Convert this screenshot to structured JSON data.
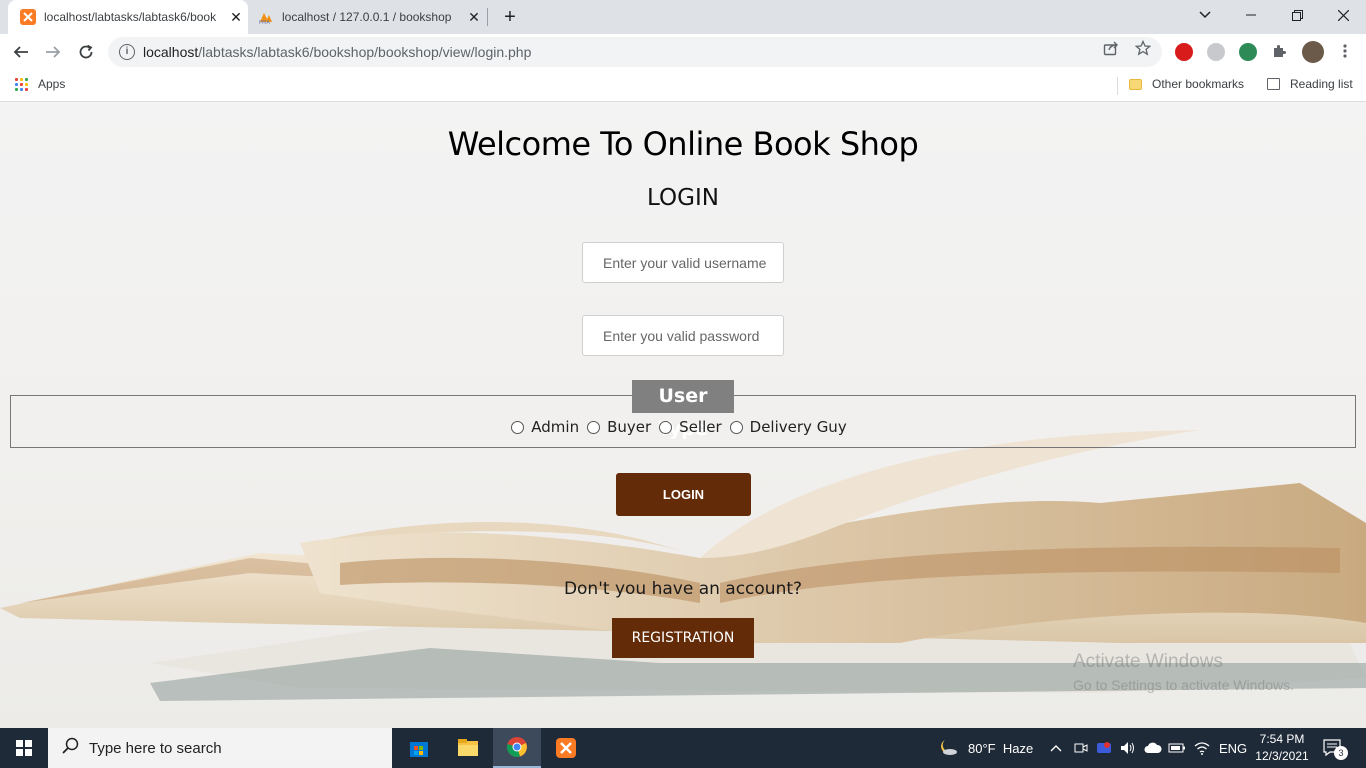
{
  "browser": {
    "tabs": [
      {
        "title": "localhost/labtasks/labtask6/book",
        "active": true
      },
      {
        "title": "localhost / 127.0.0.1 / bookshop",
        "active": false
      }
    ],
    "url_host": "localhost",
    "url_path": "/labtasks/labtask6/bookshop/bookshop/view/login.php",
    "bookmarks": {
      "apps": "Apps",
      "other": "Other bookmarks",
      "reading": "Reading list"
    }
  },
  "page": {
    "welcome": "Welcome To Online Book Shop",
    "login_heading": "LOGIN",
    "username_placeholder": "Enter your valid username",
    "password_placeholder": "Enter you valid password",
    "user_type_legend": "User Type",
    "user_types": [
      "Admin",
      "Buyer",
      "Seller",
      "Delivery Guy"
    ],
    "login_button": "LOGIN",
    "no_account": "Don't you have an account?",
    "registration_button": "REGISTRATION"
  },
  "watermark": {
    "title": "Activate Windows",
    "subtitle": "Go to Settings to activate Windows."
  },
  "taskbar": {
    "search_placeholder": "Type here to search",
    "weather": "80°F  Haze",
    "language": "ENG",
    "time": "7:54 PM",
    "date": "12/3/2021",
    "notifications": "3"
  },
  "colors": {
    "button_brown": "#632b08",
    "legend_gray": "#808080",
    "taskbar": "#1f2a38"
  }
}
